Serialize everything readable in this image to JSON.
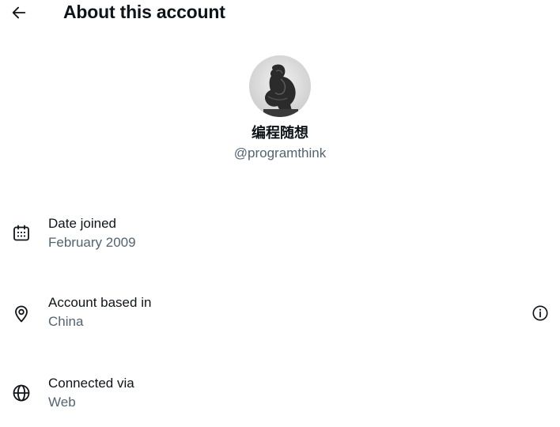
{
  "header": {
    "back_icon": "arrow-left-icon",
    "title": "About this account"
  },
  "profile": {
    "avatar_icon": "profile-avatar",
    "display_name": "编程随想",
    "handle": "@programthink"
  },
  "details": {
    "date_joined": {
      "icon": "calendar-icon",
      "label": "Date joined",
      "value": "February 2009"
    },
    "account_based_in": {
      "icon": "location-pin-icon",
      "label": "Account based in",
      "value": "China",
      "info_icon": "info-icon"
    },
    "connected_via": {
      "icon": "globe-icon",
      "label": "Connected via",
      "value": "Web"
    }
  },
  "colors": {
    "primary_text": "#0f1419",
    "secondary_text": "#536471",
    "background": "#ffffff"
  }
}
